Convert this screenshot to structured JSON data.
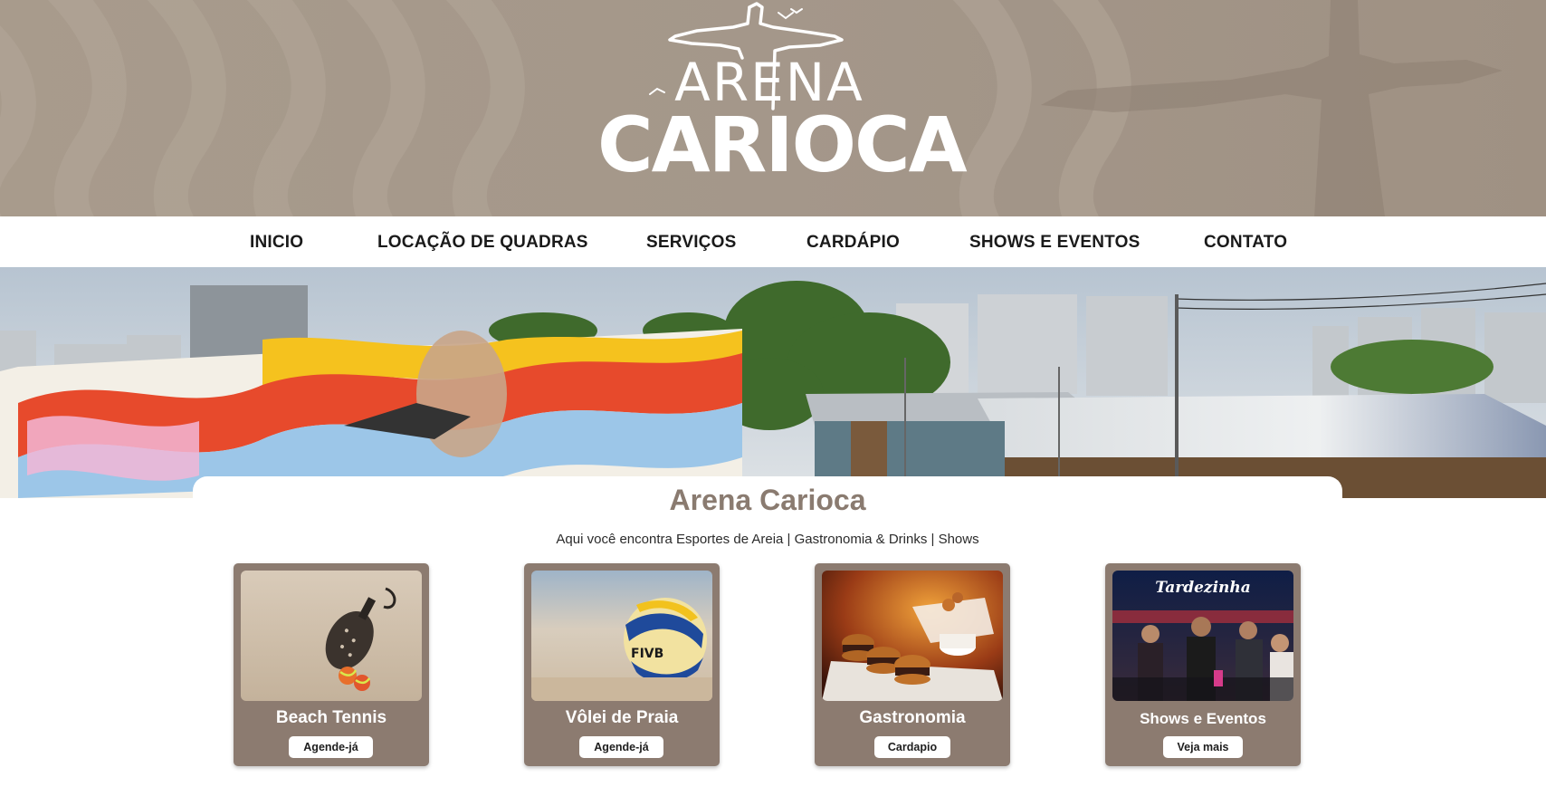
{
  "header": {
    "logo_line1": "ARENA",
    "logo_line2": "CARIOCA",
    "banner_color": "#a49687"
  },
  "nav": {
    "items": [
      {
        "label": "INICIO"
      },
      {
        "label": "LOCAÇÃO DE QUADRAS"
      },
      {
        "label": "SERVIÇOS"
      },
      {
        "label": "CARDÁPIO"
      },
      {
        "label": "SHOWS E EVENTOS"
      },
      {
        "label": "CONTATO"
      }
    ]
  },
  "main": {
    "title": "Arena Carioca",
    "subtitle": "Aqui você encontra Esportes de Areia | Gastronomia & Drinks | Shows",
    "title_color": "#8a7b70",
    "card_color": "#8c7b70"
  },
  "cards": [
    {
      "title": "Beach Tennis",
      "button": "Agende-já",
      "image": "beach-tennis-racket-photo"
    },
    {
      "title": "Vôlei de Praia",
      "button": "Agende-já",
      "image": "volleyball-on-sand-photo"
    },
    {
      "title": "Gastronomia",
      "button": "Cardapio",
      "image": "burgers-photo"
    },
    {
      "title": "Shows e Eventos",
      "button": "Veja mais",
      "image": "concert-crowd-photo",
      "image_caption": "Tardezinha"
    }
  ]
}
